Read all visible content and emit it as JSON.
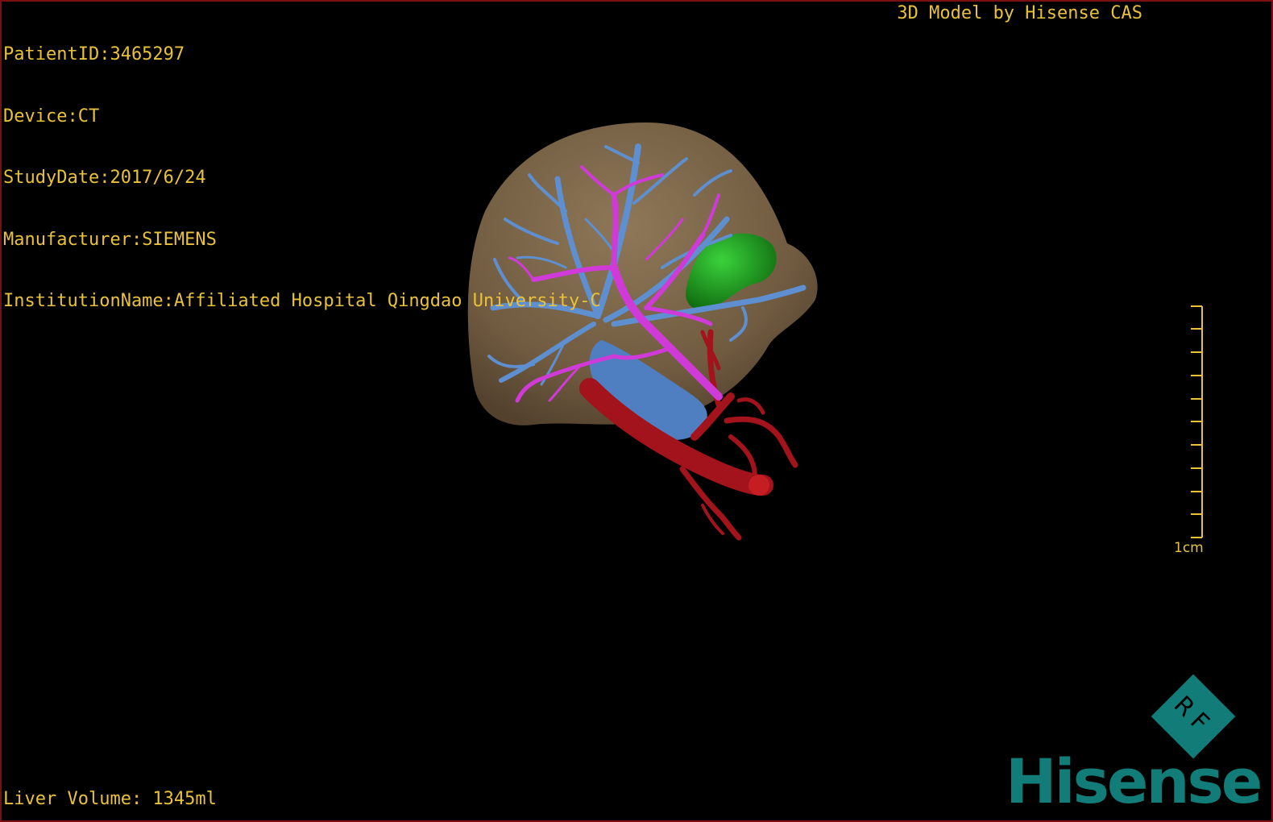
{
  "header": {
    "patient_id": "PatientID:3465297",
    "device": "Device:CT",
    "study_date": "StudyDate:2017/6/24",
    "manufacturer": "Manufacturer:SIEMENS",
    "institution": "InstitutionName:Affiliated Hospital Qingdao University-C"
  },
  "credit": "3D Model by Hisense CAS",
  "scale_bar": {
    "label": "1cm",
    "tick_count": 11
  },
  "footer": {
    "liver_volume": "Liver Volume: 1345ml"
  },
  "logo": {
    "emblem_text": "RF",
    "brand_text": "Hisense",
    "brand_color": "#127c78"
  },
  "colors": {
    "overlay_text": "#e9c23a",
    "liver": "#8a7150",
    "portal_vein": "#5e8fd0",
    "hepatic_vein": "#d03ad8",
    "artery": "#a3131b",
    "gallbladder": "#1b9a1b"
  }
}
